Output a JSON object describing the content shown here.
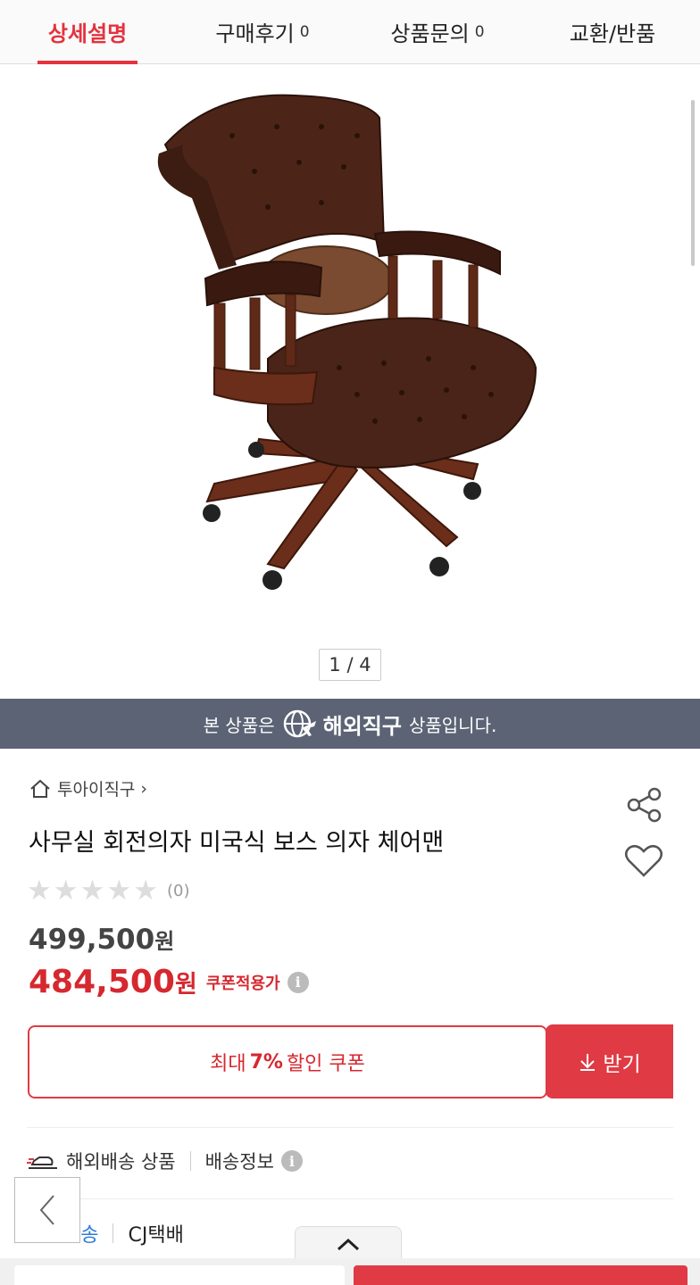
{
  "tabs": [
    {
      "label": "상세설명",
      "count": ""
    },
    {
      "label": "구매후기",
      "count": "0"
    },
    {
      "label": "상품문의",
      "count": "0"
    },
    {
      "label": "교환/반품",
      "count": ""
    }
  ],
  "gallery": {
    "pager": "1 / 4"
  },
  "banner": {
    "prefix": "본 상품은",
    "brand": "해외직구",
    "suffix": "상품입니다."
  },
  "store": {
    "name": "투아이직구",
    "chevron": "›"
  },
  "product": {
    "title": "사무실 회전의자 미국식 보스 의자 체어맨",
    "review_count": "(0)",
    "price_original": "499,500",
    "price_sale": "484,500",
    "won": "원",
    "coupon_price_label": "쿠폰적용가"
  },
  "coupon": {
    "prefix": "최대",
    "rate": "7%",
    "suffix": "할인 쿠폰",
    "button": "받기"
  },
  "shipping": {
    "type": "해외배송 상품",
    "info": "배송정보"
  },
  "delivery": {
    "label": "배송",
    "carrier": "CJ택배"
  },
  "icons": {
    "home": "home-icon",
    "share": "share-icon",
    "heart": "heart-icon",
    "info": "info-icon",
    "download": "download-icon",
    "back": "chevron-left-icon",
    "up": "chevron-up-icon",
    "globe": "globe-plane-icon",
    "ship": "ship-icon"
  },
  "colors": {
    "accent": "#e5323e",
    "banner": "#5b6375",
    "sale": "#d6282f"
  }
}
